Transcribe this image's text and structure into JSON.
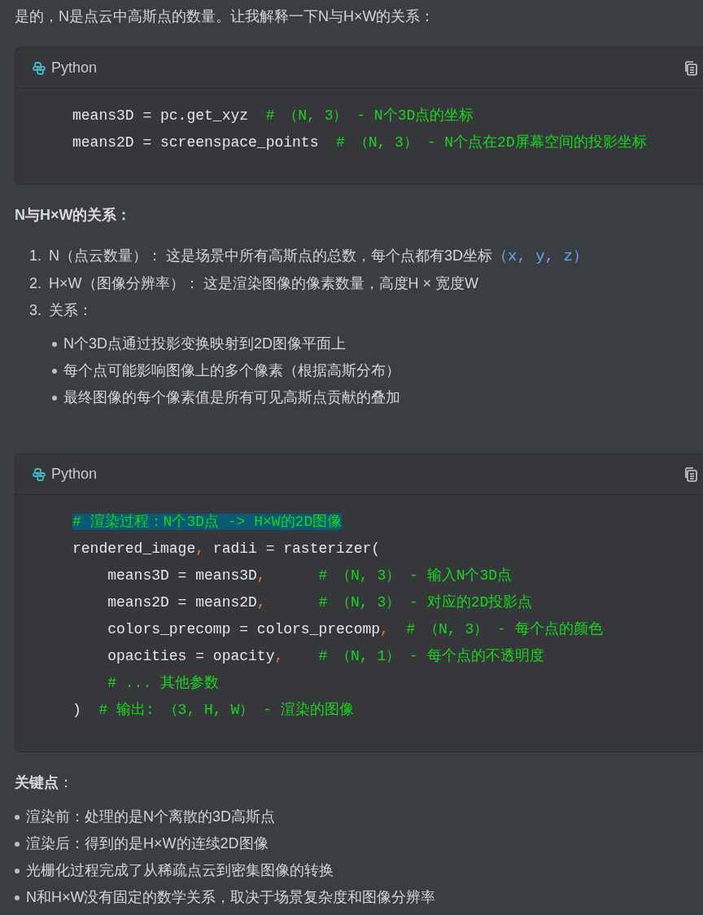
{
  "intro": "是的，N是点云中高斯点的数量。让我解释一下N与H×W的关系：",
  "code_blocks": [
    {
      "language": "Python",
      "lines": [
        {
          "highlighted": false,
          "tokens": [
            {
              "kind": "plain",
              "text": "means3D = pc.get_xyz  "
            },
            {
              "kind": "comment",
              "text": "# （N, 3） - N个3D点的坐标"
            }
          ]
        },
        {
          "highlighted": false,
          "tokens": [
            {
              "kind": "plain",
              "text": "means2D = screenspace_points  "
            },
            {
              "kind": "comment",
              "text": "# （N, 3） - N个点在2D屏幕空间的投影坐标"
            }
          ]
        }
      ]
    }
  ],
  "section_heading": "N与H×W的关系：",
  "numbered_list": [
    {
      "number": "1.",
      "text": "N（点云数量）： 这是场景中所有高斯点的总数，每个点都有3D坐标",
      "code": "（x, y, z）"
    },
    {
      "number": "2.",
      "text": "H×W（图像分辨率）： 这是渲染图像的像素数量，高度H × 宽度W"
    },
    {
      "number": "3.",
      "text": "关系：",
      "children": [
        "N个3D点通过投影变换映射到2D图像平面上",
        "每个点可能影响图像上的多个像素（根据高斯分布）",
        "最终图像的每个像素值是所有可见高斯点贡献的叠加"
      ]
    }
  ],
  "code_block_2": {
    "language": "Python",
    "lines": [
      {
        "highlighted": true,
        "tokens": [
          {
            "kind": "comment",
            "text": "# 渲染过程：N个3D点 -> H×W的2D图像"
          }
        ]
      },
      {
        "highlighted": false,
        "tokens": [
          {
            "kind": "plain",
            "text": "rendered_image"
          },
          {
            "kind": "punct",
            "text": ","
          },
          {
            "kind": "plain",
            "text": " radii = rasterizer("
          }
        ]
      },
      {
        "highlighted": false,
        "tokens": [
          {
            "kind": "plain",
            "text": "    means3D = means3D"
          },
          {
            "kind": "punct",
            "text": ",      "
          },
          {
            "kind": "comment",
            "text": "# （N, 3） - 输入N个3D点"
          }
        ]
      },
      {
        "highlighted": false,
        "tokens": [
          {
            "kind": "plain",
            "text": "    means2D = means2D"
          },
          {
            "kind": "punct",
            "text": ",      "
          },
          {
            "kind": "comment",
            "text": "# （N, 3） - 对应的2D投影点"
          }
        ]
      },
      {
        "highlighted": false,
        "tokens": [
          {
            "kind": "plain",
            "text": "    colors_precomp = colors_precomp"
          },
          {
            "kind": "punct",
            "text": ",  "
          },
          {
            "kind": "comment",
            "text": "# （N, 3） - 每个点的颜色"
          }
        ]
      },
      {
        "highlighted": false,
        "tokens": [
          {
            "kind": "plain",
            "text": "    opacities = opacity"
          },
          {
            "kind": "punct",
            "text": ",    "
          },
          {
            "kind": "comment",
            "text": "# （N, 1） - 每个点的不透明度"
          }
        ]
      },
      {
        "highlighted": false,
        "tokens": [
          {
            "kind": "comment",
            "text": "    # ... 其他参数"
          }
        ]
      },
      {
        "highlighted": false,
        "tokens": [
          {
            "kind": "plain",
            "text": ")  "
          },
          {
            "kind": "comment",
            "text": "# 输出: （3, H, W） - 渲染的图像"
          }
        ]
      }
    ]
  },
  "key_points_heading": "**关键点**：",
  "key_points": [
    "渲染前：处理的是N个离散的3D高斯点",
    "渲染后：得到的是H×W的连续2D图像",
    "光栅化过程完成了从稀疏点云到密集图像的转换",
    "N和H×W没有固定的数学关系，取决于场景复杂度和图像分辨率"
  ]
}
